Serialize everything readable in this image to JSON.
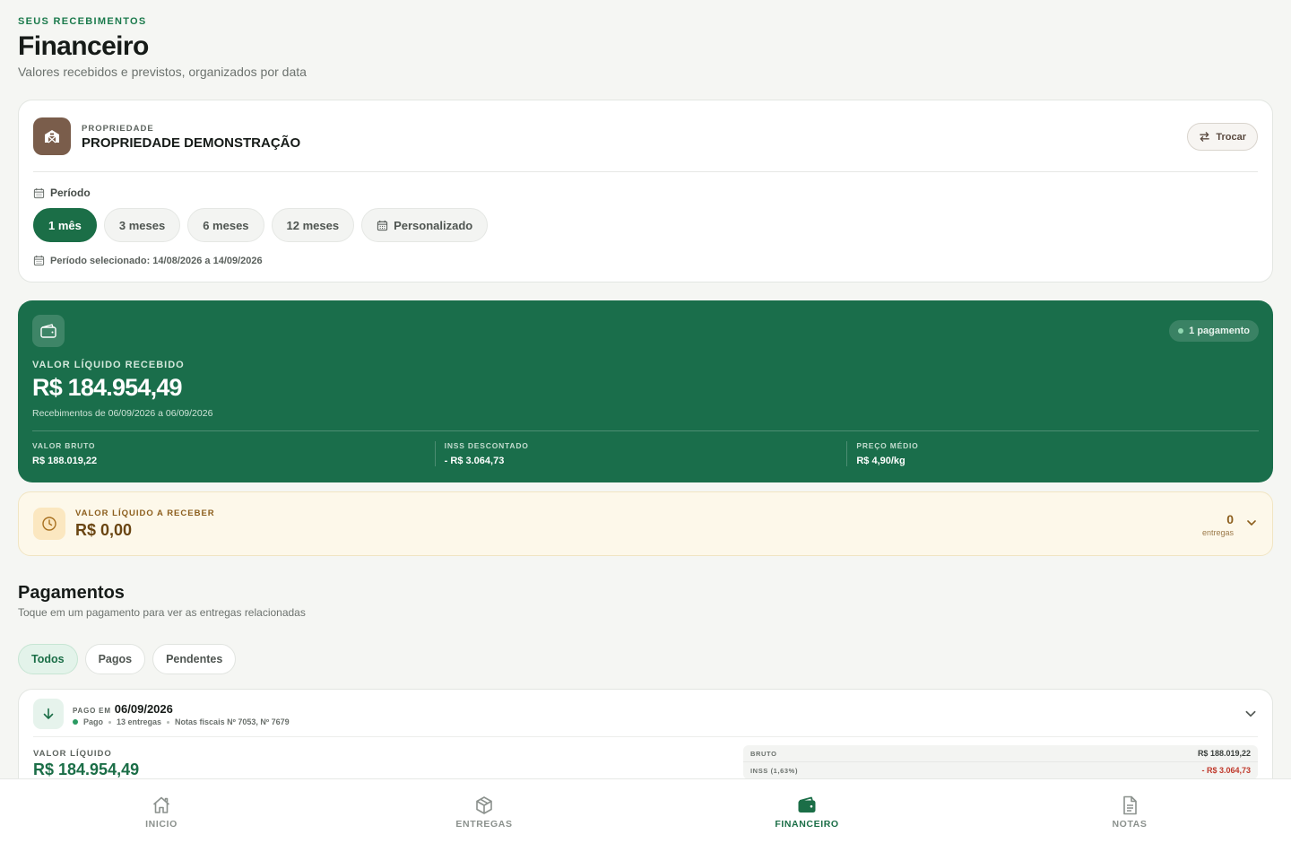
{
  "header": {
    "eyebrow": "SEUS RECEBIMENTOS",
    "title": "Financeiro",
    "subtitle": "Valores recebidos e previstos, organizados por data"
  },
  "property": {
    "eyebrow": "PROPRIEDADE",
    "name": "PROPRIEDADE DEMONSTRAÇÃO",
    "icon": "barn-icon",
    "swap_label": "Trocar"
  },
  "period": {
    "label": "Período",
    "options": [
      "1 mês",
      "3 meses",
      "6 meses",
      "12 meses",
      "Personalizado"
    ],
    "selected": "1 mês",
    "selected_text": "Período selecionado: 14/08/2026 a 14/09/2026"
  },
  "summary": {
    "badge": "1 pagamento",
    "eyebrow": "VALOR LÍQUIDO RECEBIDO",
    "value": "R$ 184.954,49",
    "range": "Recebimentos de 06/09/2026 a 06/09/2026",
    "columns": [
      {
        "label": "VALOR BRUTO",
        "value": "R$ 188.019,22"
      },
      {
        "label": "INSS DESCONTADO",
        "value": "- R$ 3.064,73"
      },
      {
        "label": "PREÇO MÉDIO",
        "value": "R$ 4,90/kg"
      }
    ],
    "colors": {
      "card": "#1a6e4b"
    }
  },
  "pending": {
    "eyebrow": "VALOR LÍQUIDO A RECEBER",
    "value": "R$ 0,00",
    "count": "0",
    "count_unit": "entregas"
  },
  "payments": {
    "title": "Pagamentos",
    "subtitle": "Toque em um pagamento para ver as entregas relacionadas",
    "filters": [
      "Todos",
      "Pagos",
      "Pendentes"
    ],
    "active_filter": "Todos",
    "items": [
      {
        "paid_label": "PAGO EM",
        "date": "06/09/2026",
        "status": "Pago",
        "deliveries": "13 entregas",
        "invoices": "Notas fiscais Nº 7053, Nº 7679",
        "net_label": "VALOR LÍQUIDO",
        "net_value": "R$ 184.954,49",
        "breakdown": [
          {
            "label": "BRUTO",
            "value": "R$ 188.019,22"
          },
          {
            "label": "INSS (1,63%)",
            "value": "- R$ 3.064,73"
          }
        ]
      }
    ]
  },
  "nav": {
    "items": [
      {
        "label": "INICIO",
        "icon": "home-icon"
      },
      {
        "label": "ENTREGAS",
        "icon": "box-icon"
      },
      {
        "label": "FINANCEIRO",
        "icon": "wallet-icon"
      },
      {
        "label": "NOTAS",
        "icon": "document-icon"
      }
    ],
    "active": "FINANCEIRO",
    "colors": {
      "accent": "#1b6e47",
      "inactive": "#8b918d"
    }
  }
}
